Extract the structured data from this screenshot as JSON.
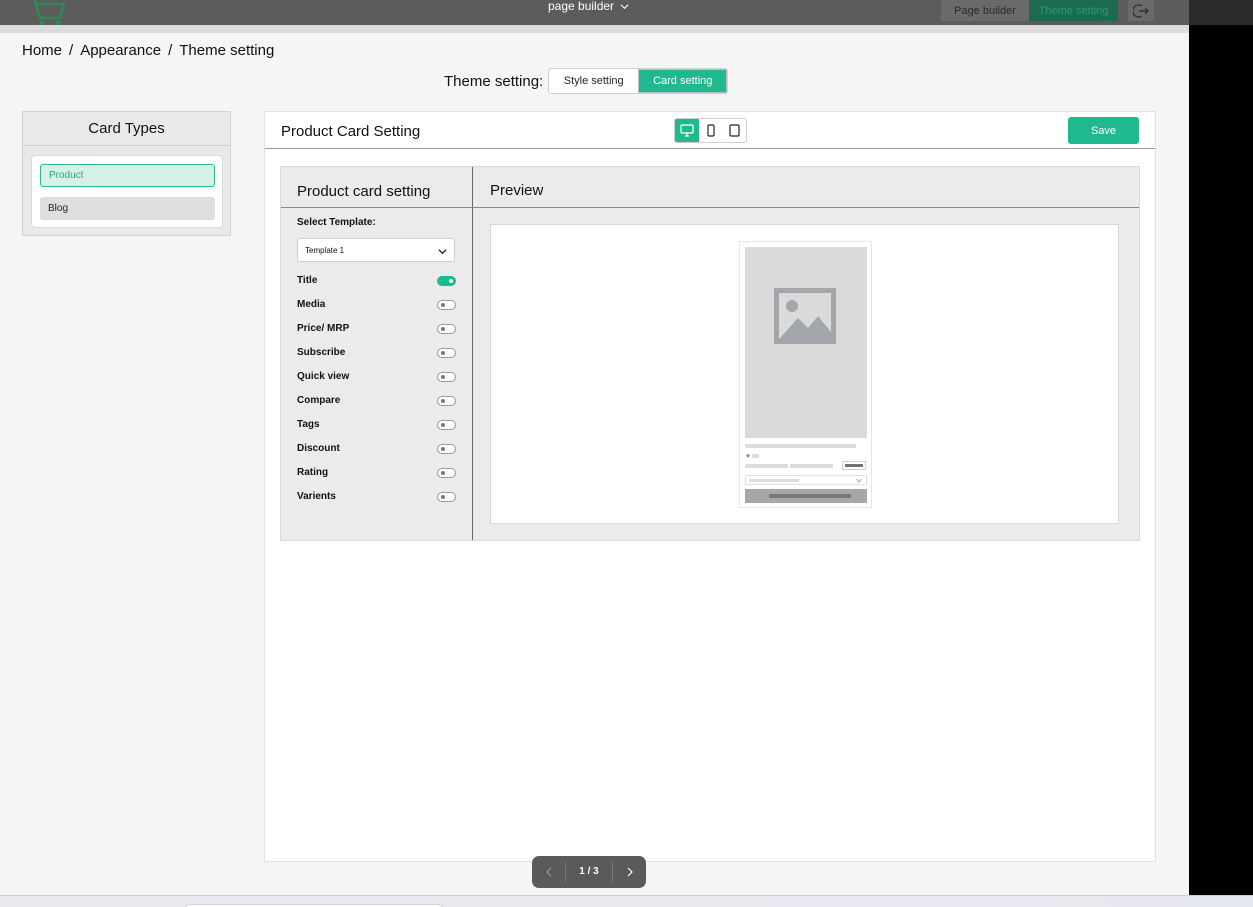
{
  "topbar": {
    "menu_label": "page builder",
    "page_builder_button": "Page builder",
    "theme_setting_button": "Theme setting"
  },
  "breadcrumb": {
    "items": [
      "Home",
      "Appearance",
      "Theme setting"
    ],
    "separator": "/"
  },
  "theme_setting": {
    "label": "Theme setting:",
    "tabs": [
      {
        "label": "Style setting",
        "active": false
      },
      {
        "label": "Card setting",
        "active": true
      }
    ]
  },
  "card_types": {
    "title": "Card Types",
    "items": [
      {
        "label": "Product",
        "selected": true
      },
      {
        "label": "Blog",
        "selected": false
      }
    ]
  },
  "main": {
    "title": "Product Card Setting",
    "devices": [
      "desktop-icon",
      "mobile-icon",
      "tablet-icon"
    ],
    "active_device": "desktop-icon",
    "save_label": "Save"
  },
  "settings": {
    "title": "Product card setting",
    "select_label": "Select Template:",
    "template_value": "Template 1",
    "options": [
      {
        "label": "Title",
        "on": true
      },
      {
        "label": "Media",
        "on": false
      },
      {
        "label": "Price/ MRP",
        "on": false
      },
      {
        "label": "Subscribe",
        "on": false
      },
      {
        "label": "Quick view",
        "on": false
      },
      {
        "label": "Compare",
        "on": false
      },
      {
        "label": "Tags",
        "on": false
      },
      {
        "label": "Discount",
        "on": false
      },
      {
        "label": "Rating",
        "on": false
      },
      {
        "label": "Varients",
        "on": false
      }
    ]
  },
  "preview": {
    "title": "Preview"
  },
  "pager": {
    "count": "1 / 3"
  },
  "colors": {
    "accent": "#1fb88f",
    "topbar": "#5c5c5c"
  }
}
